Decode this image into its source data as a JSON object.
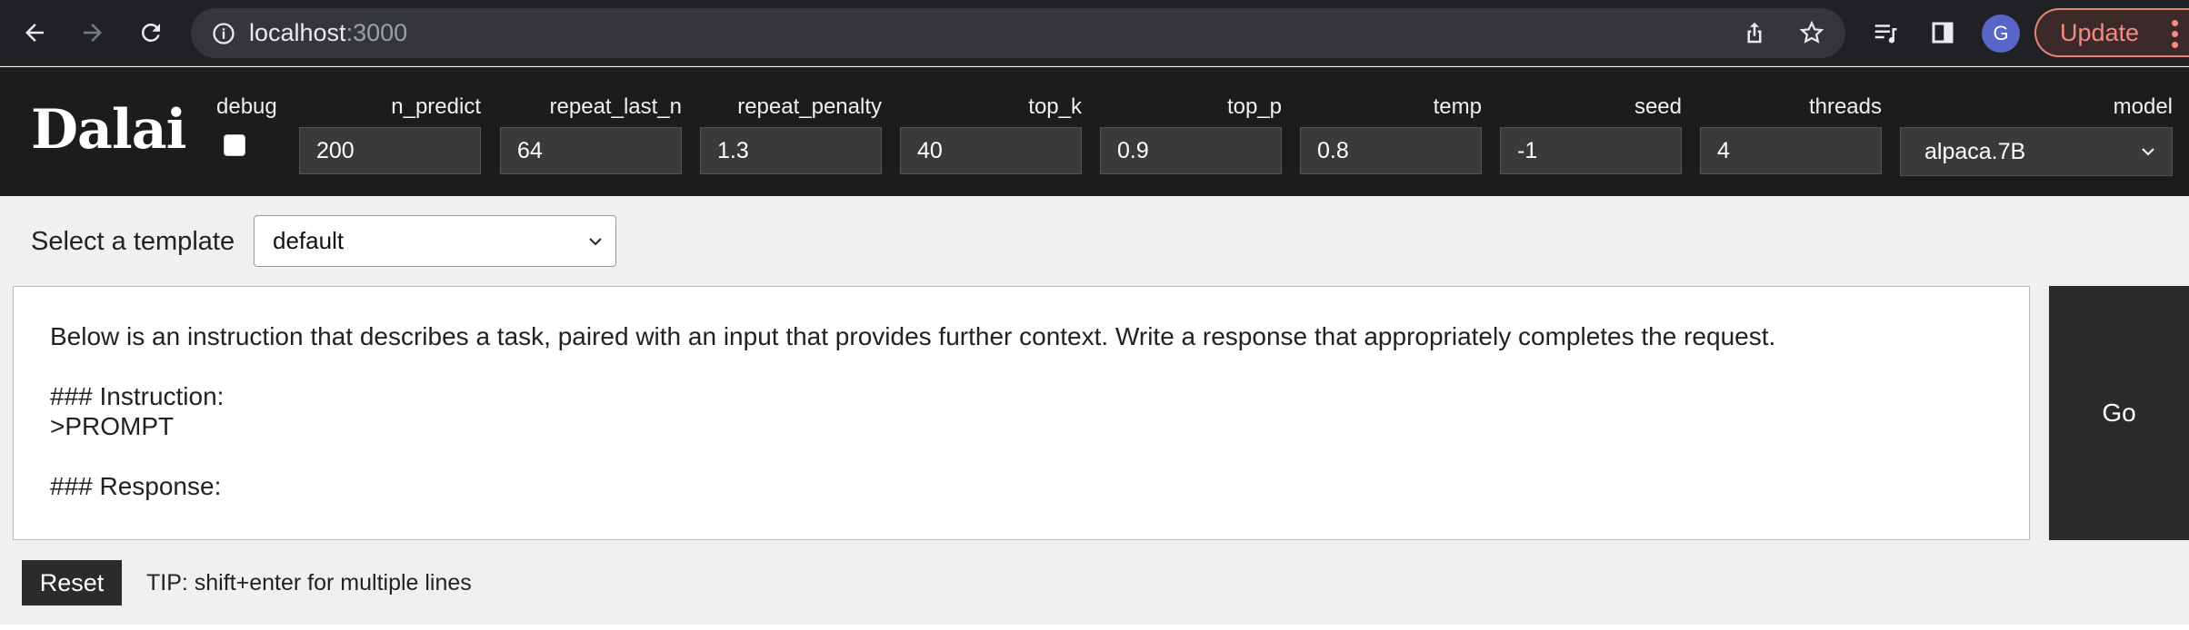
{
  "browser": {
    "url_host": "localhost",
    "url_port": ":3000",
    "avatar_letter": "G",
    "update_label": "Update",
    "icons": [
      "back-icon",
      "forward-icon",
      "reload-icon",
      "info-icon",
      "share-icon",
      "star-icon",
      "reading-list-icon",
      "side-panel-icon",
      "more-icon"
    ]
  },
  "app": {
    "logo": "Dalai",
    "params": {
      "debug_label": "debug",
      "debug_checked": false,
      "n_predict": {
        "label": "n_predict",
        "value": "200"
      },
      "repeat_last_n": {
        "label": "repeat_last_n",
        "value": "64"
      },
      "repeat_penalty": {
        "label": "repeat_penalty",
        "value": "1.3"
      },
      "top_k": {
        "label": "top_k",
        "value": "40"
      },
      "top_p": {
        "label": "top_p",
        "value": "0.9"
      },
      "temp": {
        "label": "temp",
        "value": "0.8"
      },
      "seed": {
        "label": "seed",
        "value": "-1"
      },
      "threads": {
        "label": "threads",
        "value": "4"
      },
      "model": {
        "label": "model",
        "value": "alpaca.7B"
      }
    },
    "template": {
      "label": "Select a template",
      "value": "default"
    },
    "prompt": {
      "line1": "Below is an instruction that describes a task, paired with an input that provides further context. Write a response that appropriately completes the request.",
      "line2": "### Instruction:",
      "line3": ">PROMPT",
      "line4": "### Response:"
    },
    "go_label": "Go",
    "reset_label": "Reset",
    "tip": "TIP: shift+enter for multiple lines"
  }
}
